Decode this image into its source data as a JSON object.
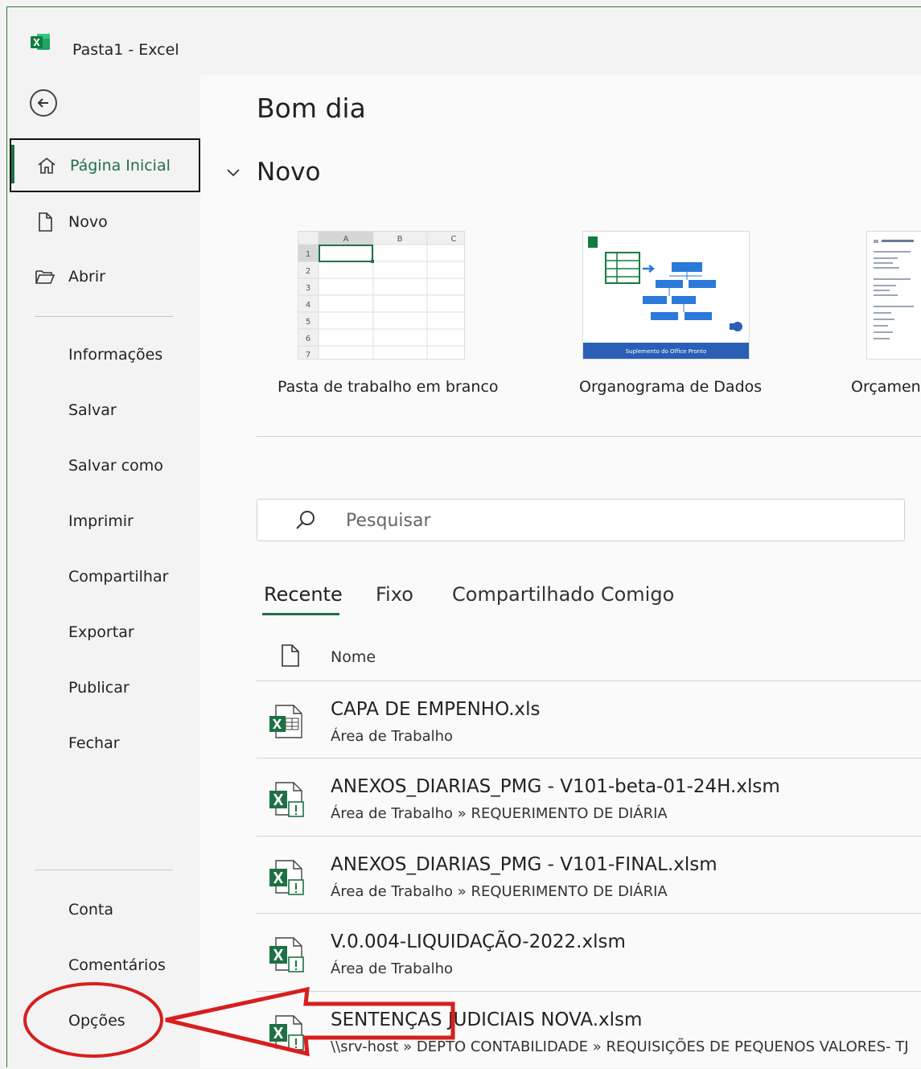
{
  "window": {
    "title": "Pasta1  -  Excel",
    "app_icon": "excel-logo-icon"
  },
  "sidebar": {
    "back_icon": "back-arrow-icon",
    "items": [
      {
        "label": "Página Inicial",
        "icon": "home-icon",
        "selected": true
      },
      {
        "label": "Novo",
        "icon": "new-document-icon"
      },
      {
        "label": "Abrir",
        "icon": "open-folder-icon"
      },
      {
        "label": "Informações"
      },
      {
        "label": "Salvar"
      },
      {
        "label": "Salvar como"
      },
      {
        "label": "Imprimir"
      },
      {
        "label": "Compartilhar"
      },
      {
        "label": "Exportar"
      },
      {
        "label": "Publicar"
      },
      {
        "label": "Fechar"
      }
    ],
    "bottom_items": [
      {
        "label": "Conta"
      },
      {
        "label": "Comentários"
      },
      {
        "label": "Opções"
      }
    ]
  },
  "main": {
    "greeting": "Bom dia",
    "new_section": {
      "title": "Novo",
      "templates": [
        {
          "label": "Pasta de trabalho em branco",
          "grid_cols": [
            "A",
            "B",
            "C"
          ],
          "grid_rows": [
            "1",
            "2",
            "3",
            "4",
            "5",
            "6",
            "7"
          ]
        },
        {
          "label": "Organograma de Dados",
          "banner": "Suplemento do Office Pronto"
        },
        {
          "label": "Orçamen"
        }
      ]
    },
    "search": {
      "placeholder": "Pesquisar",
      "value": ""
    },
    "tabs": [
      {
        "label": "Recente",
        "active": true
      },
      {
        "label": "Fixo"
      },
      {
        "label": "Compartilhado Comigo"
      }
    ],
    "list_header": {
      "name": "Nome"
    },
    "files": [
      {
        "name": "CAPA DE EMPENHO.xls",
        "path": "Área de Trabalho",
        "icon": "excel-legacy-file-icon"
      },
      {
        "name": "ANEXOS_DIARIAS_PMG - V101-beta-01-24H.xlsm",
        "path": "Área de Trabalho » REQUERIMENTO DE DIÁRIA",
        "icon": "excel-macro-file-icon"
      },
      {
        "name": "ANEXOS_DIARIAS_PMG - V101-FINAL.xlsm",
        "path": "Área de Trabalho » REQUERIMENTO DE DIÁRIA",
        "icon": "excel-macro-file-icon"
      },
      {
        "name": "V.0.004-LIQUIDAÇÃO-2022.xlsm",
        "path": "Área de Trabalho",
        "icon": "excel-macro-file-icon"
      },
      {
        "name": "SENTENÇAS JUDICIAIS NOVA.xlsm",
        "path": "\\\\srv-host » DEPTO CONTABILIDADE » REQUISIÇÕES DE PEQUENOS VALORES- TJ",
        "icon": "excel-macro-file-icon"
      }
    ]
  },
  "colors": {
    "accent": "#1e7145",
    "annotation": "#d81e1e"
  }
}
